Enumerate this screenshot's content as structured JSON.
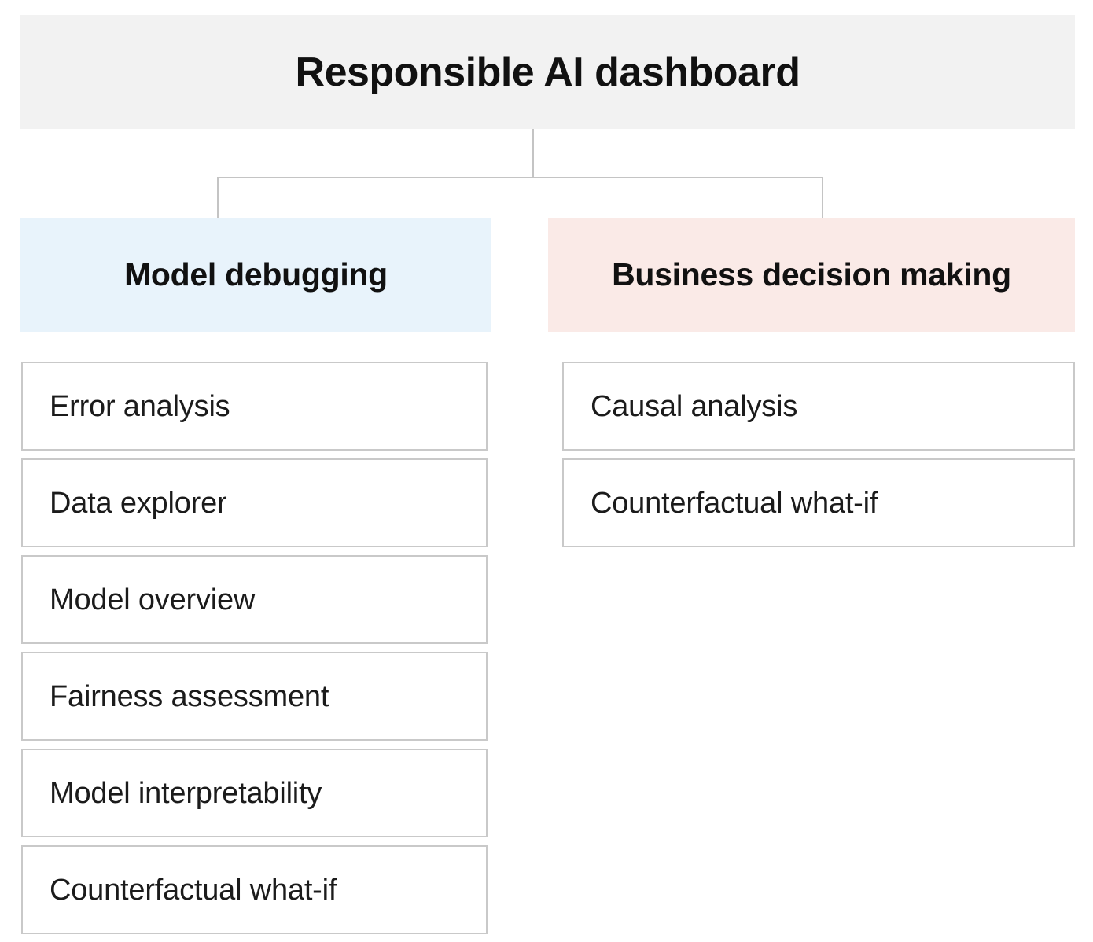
{
  "diagram": {
    "root": {
      "title": "Responsible AI dashboard",
      "background_color": "#f2f2f2"
    },
    "branches": [
      {
        "id": "model-debugging",
        "title": "Model debugging",
        "background_color": "#e8f3fb",
        "components": [
          {
            "label": "Error analysis"
          },
          {
            "label": "Data explorer"
          },
          {
            "label": "Model overview"
          },
          {
            "label": "Fairness assessment"
          },
          {
            "label": "Model interpretability"
          },
          {
            "label": "Counterfactual what-if"
          }
        ]
      },
      {
        "id": "business-decision-making",
        "title": "Business decision making",
        "background_color": "#faeae7",
        "components": [
          {
            "label": "Causal analysis"
          },
          {
            "label": "Counterfactual what-if"
          }
        ]
      }
    ],
    "connector_color": "#c4c4c4",
    "component_border_color": "#c9c9c9",
    "text_color": "#111111"
  }
}
